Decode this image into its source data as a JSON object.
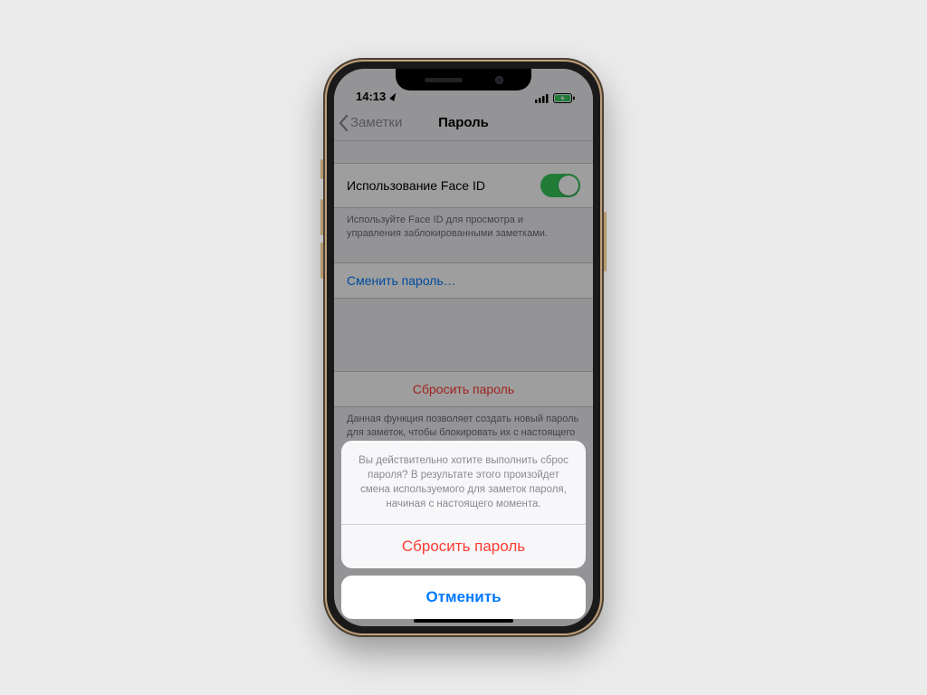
{
  "status": {
    "time": "14:13"
  },
  "nav": {
    "back": "Заметки",
    "title": "Пароль"
  },
  "faceid": {
    "label": "Использование Face ID",
    "footer": "Используйте Face ID для просмотра и управления заблокированными заметками."
  },
  "change_password": {
    "label": "Сменить пароль…"
  },
  "reset_password": {
    "label": "Сбросить пароль",
    "footer": "Данная функция позволяет создать новый пароль для заметок, чтобы блокировать их с настоящего момента. Заметки, уже имеющие пароль, затронуты не будут."
  },
  "sheet": {
    "message": "Вы действительно хотите выполнить сброс пароля? В результате этого произойдет смена используемого для заметок пароля, начиная с настоящего момента.",
    "reset": "Сбросить пароль",
    "cancel": "Отменить"
  }
}
